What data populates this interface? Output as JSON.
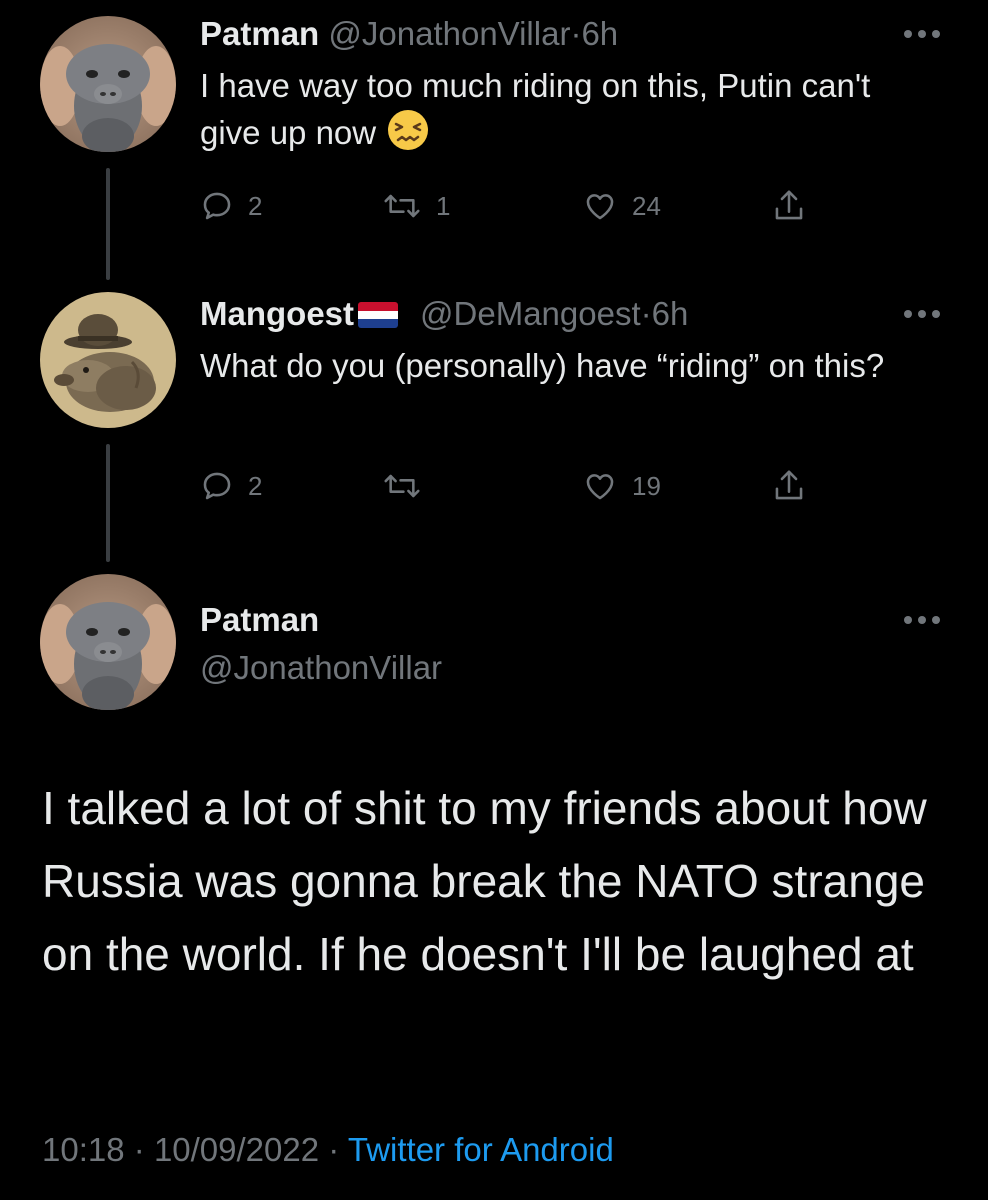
{
  "tweets": [
    {
      "name": "Patman",
      "handle": "@JonathonVillar",
      "separator": "·",
      "time": "6h",
      "text": "I have way too much riding on this, Putin can't give up now",
      "emoji": "persevering-face-emoji",
      "replies": "2",
      "retweets": "1",
      "likes": "24",
      "avatar": "orangutan-avatar"
    },
    {
      "name": "Mangoest",
      "flag": "netherlands-flag",
      "handle": "@DeMangoest",
      "separator": "·",
      "time": "6h",
      "text": "What do you (personally) have “riding” on this?",
      "replies": "2",
      "retweets": "",
      "likes": "19",
      "avatar": "mongoose-in-hat-avatar"
    }
  ],
  "main_tweet": {
    "name": "Patman",
    "handle": "@JonathonVillar",
    "text": "I talked a lot of shit to my friends about how Russia was gonna break the NATO strange on the world. If he doesn't I'll be laughed at",
    "time": "10:18",
    "separator": "·",
    "date": "10/09/2022",
    "separator2": "·",
    "source": "Twitter for Android",
    "avatar": "orangutan-avatar"
  },
  "colors": {
    "background": "#000000",
    "primary_text": "#e7e9ea",
    "secondary_text": "#71767b",
    "link": "#1d9bf0",
    "thread_line": "#3a3e42"
  },
  "icons": [
    "reply-icon",
    "retweet-icon",
    "like-icon",
    "share-icon",
    "more-options-icon"
  ]
}
